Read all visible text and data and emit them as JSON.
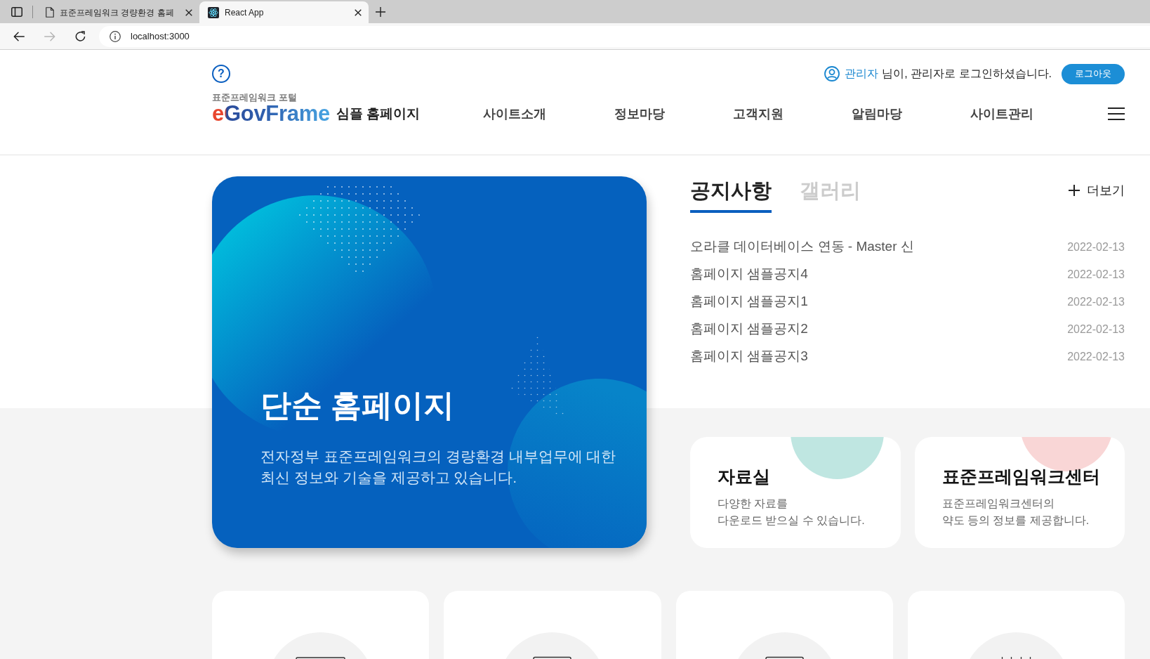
{
  "browser": {
    "tabs": [
      {
        "title": "표준프레임워크 경량환경 홈페",
        "selected": false,
        "kind": "document"
      },
      {
        "title": "React App",
        "selected": true,
        "kind": "app"
      }
    ],
    "address": "localhost:3000"
  },
  "header": {
    "help": "?",
    "user": {
      "name": "관리자",
      "message": "님이, 관리자로 로그인하셨습니다."
    },
    "logout": "로그아웃",
    "logo": {
      "caption": "표준프레임워크 **포털**",
      "wordmark": "eGovFrame",
      "title": "심플 홈페이지"
    },
    "nav": [
      "사이트소개",
      "정보마당",
      "고객지원",
      "알림마당",
      "사이트관리"
    ]
  },
  "hero": {
    "title": "단순 홈페이지",
    "description": "전자정부 표준프레임워크의 경량환경 내부업무에 대한\n최신 정보와 기술을 제공하고 있습니다."
  },
  "board": {
    "tabs": [
      {
        "label": "공지사항",
        "selected": true
      },
      {
        "label": "갤러리",
        "selected": false
      }
    ],
    "more": "더보기",
    "notices": [
      {
        "title": "오라클 데이터베이스 연동 - Master 신",
        "date": "2022-02-13"
      },
      {
        "title": "홈페이지 샘플공지4",
        "date": "2022-02-13"
      },
      {
        "title": "홈페이지 샘플공지1",
        "date": "2022-02-13"
      },
      {
        "title": "홈페이지 샘플공지2",
        "date": "2022-02-13"
      },
      {
        "title": "홈페이지 샘플공지3",
        "date": "2022-02-13"
      }
    ]
  },
  "cards": [
    {
      "title": "자료실",
      "description": "다양한 자료를\n다운로드 받으실 수 있습니다.",
      "color": "#bfe6e1"
    },
    {
      "title": "표준프레임워크센터",
      "description": "표준프레임워크센터의\n약도 등의 정보를 제공합니다.",
      "color": "#f9d6d6"
    }
  ],
  "shortcuts": [
    {
      "kind": "wide"
    },
    {
      "kind": "narrow"
    },
    {
      "kind": "narrow"
    },
    {
      "kind": "ticks"
    }
  ]
}
